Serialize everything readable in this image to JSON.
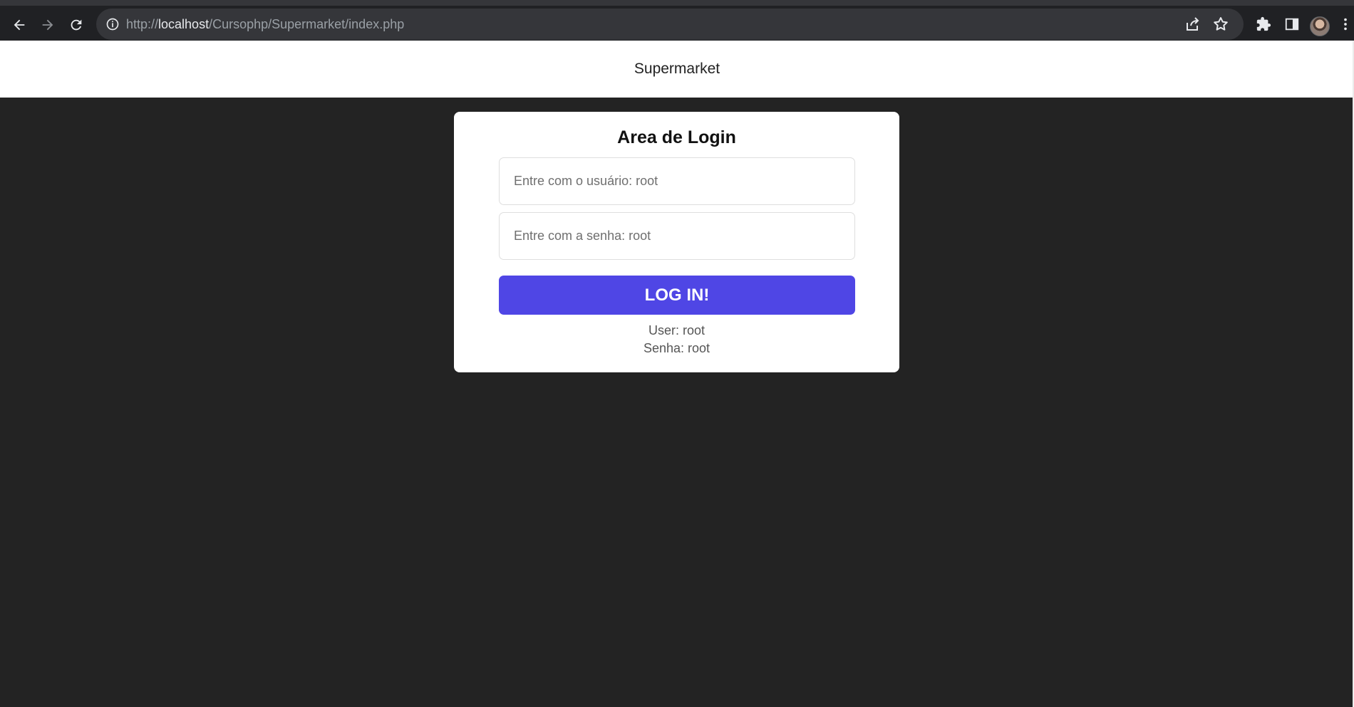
{
  "browser": {
    "url_prefix": "http://",
    "url_host": "localhost",
    "url_path": "/Cursophp/Supermarket/index.php"
  },
  "header": {
    "title": "Supermarket"
  },
  "login": {
    "title": "Area de Login",
    "username_placeholder": "Entre com o usuário: root",
    "password_placeholder": "Entre com a senha: root",
    "button_label": "LOG IN!",
    "hint_user": "User: root",
    "hint_password": "Senha: root"
  },
  "colors": {
    "page_background": "#232323",
    "button": "#4f46e5",
    "card": "#ffffff"
  },
  "icons": {
    "back": "arrow-left-icon",
    "forward": "arrow-right-icon",
    "reload": "reload-icon",
    "site_info": "info-icon",
    "share": "share-icon",
    "bookmark": "star-icon",
    "extensions": "puzzle-icon",
    "side_panel": "side-panel-icon",
    "menu": "kebab-menu-icon"
  }
}
